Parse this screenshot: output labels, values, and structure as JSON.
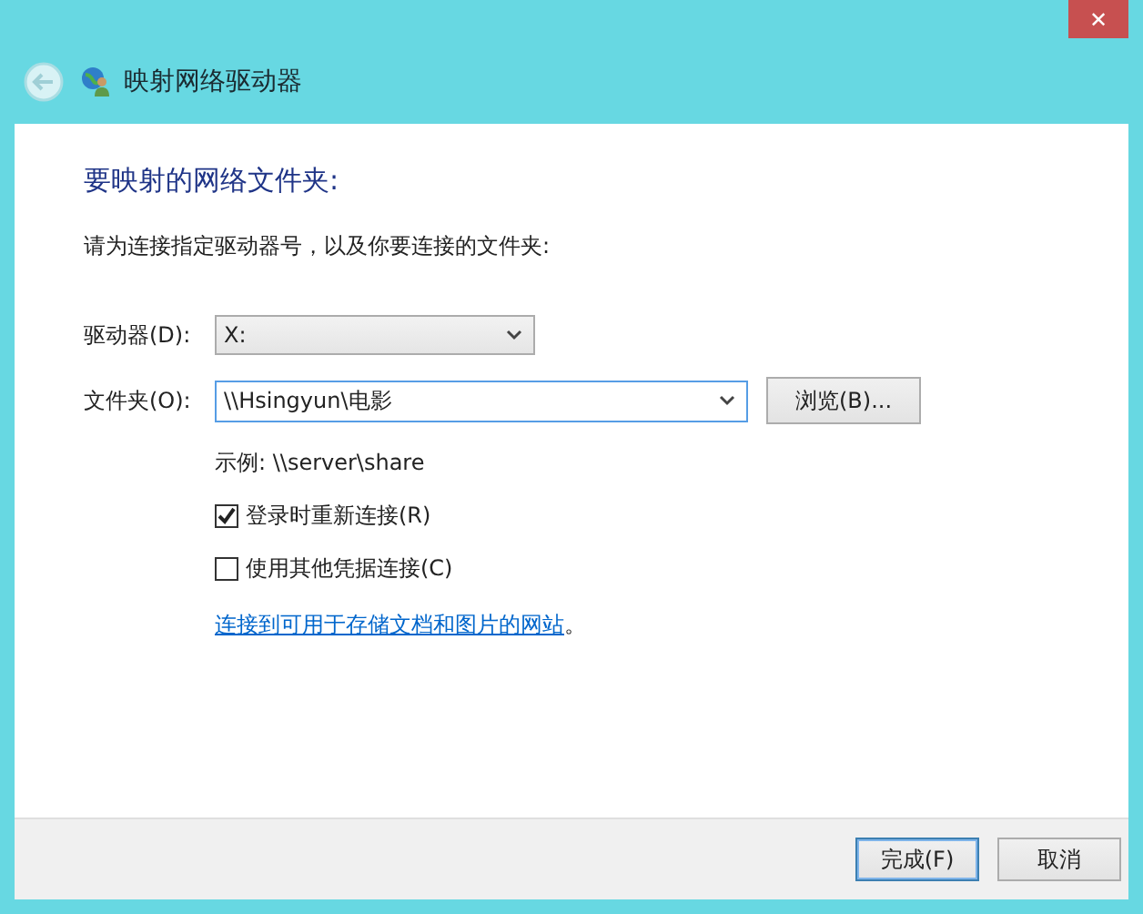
{
  "window": {
    "title": "映射网络驱动器",
    "close": "✕"
  },
  "heading": "要映射的网络文件夹:",
  "instruction": "请为连接指定驱动器号，以及你要连接的文件夹:",
  "drive": {
    "label": "驱动器(D):",
    "value": "X:"
  },
  "folder": {
    "label": "文件夹(O):",
    "value": "\\\\Hsingyun\\电影",
    "browse": "浏览(B)..."
  },
  "example": "示例: \\\\server\\share",
  "options": [
    {
      "label": "登录时重新连接(R)",
      "checked": true
    },
    {
      "label": "使用其他凭据连接(C)",
      "checked": false
    }
  ],
  "link": "连接到可用于存储文档和图片的网站",
  "link_suffix": "。",
  "buttons": [
    {
      "label": "完成(F)",
      "default": true
    },
    {
      "label": "取消",
      "default": false
    }
  ]
}
